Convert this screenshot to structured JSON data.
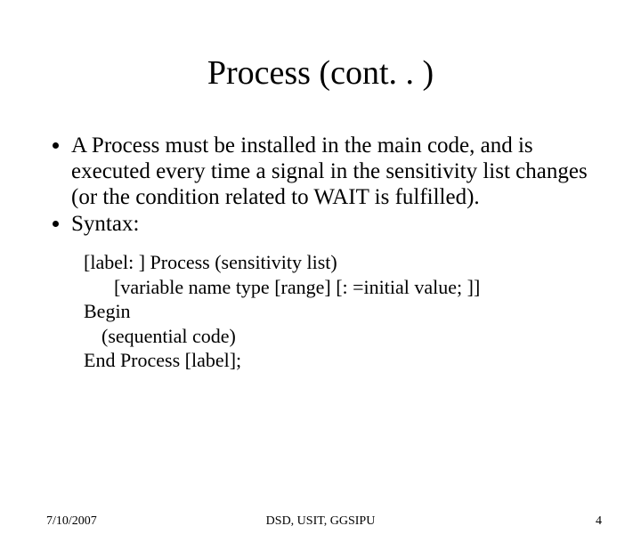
{
  "title": "Process (cont. . )",
  "bullets": [
    "A Process must be installed in the main code, and is executed every time a signal in the sensitivity list changes (or the condition related to WAIT is fulfilled).",
    "Syntax:"
  ],
  "syntax": {
    "l1": "[label: ] Process (sensitivity list)",
    "l2": "[variable name type [range] [: =initial value; ]]",
    "l3": "Begin",
    "l4": "(sequential code)",
    "l5": "End Process [label];"
  },
  "footer": {
    "date": "7/10/2007",
    "center": "DSD, USIT, GGSIPU",
    "page": "4"
  }
}
